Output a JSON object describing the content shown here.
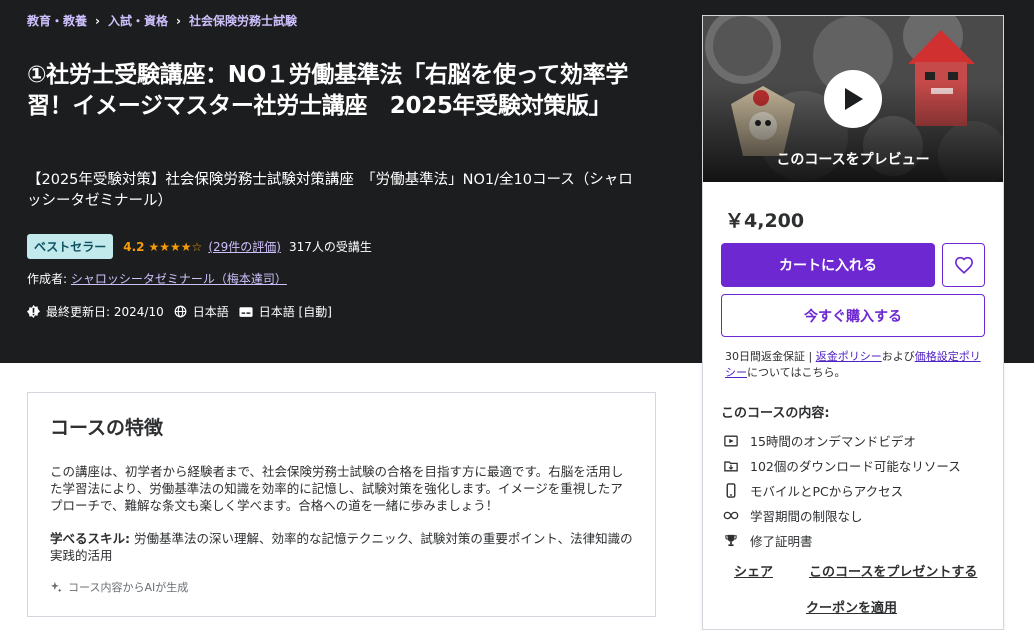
{
  "breadcrumb": [
    "教育・教養",
    "入試・資格",
    "社会保険労務士試験"
  ],
  "course": {
    "title": "①社労士受験講座：NO１労働基準法「右脳を使って効率学習！イメージマスター社労士講座　2025年受験対策版」",
    "subtitle": "【2025年受験対策】社会保険労務士試験対策講座　「労働基準法」NO1/全10コース（シャロッシータゼミナール）",
    "badge": "ベストセラー",
    "rating": "4.2",
    "stars": "★★★★☆",
    "reviews": "(29件の評価)",
    "students": "317人の受講生",
    "author_label": "作成者:",
    "author": "シャロッシータゼミナール（梅本達司）",
    "updated": "最終更新日: 2024/10",
    "language": "日本語",
    "captions": "日本語 [自動]"
  },
  "sidebar": {
    "preview_label": "このコースをプレビュー",
    "price": "￥4,200",
    "cart_label": "カートに入れる",
    "buy_label": "今すぐ購入する",
    "guarantee_prefix": "30日間返金保証 | ",
    "refund_policy": "返金ポリシー",
    "and": "および",
    "pricing_policy": "価格設定ポリシー",
    "guarantee_suffix": "についてはこちら。",
    "includes_title": "このコースの内容:",
    "includes": [
      {
        "icon": "video-icon",
        "text": "15時間のオンデマンドビデオ"
      },
      {
        "icon": "download-icon",
        "text": "102個のダウンロード可能なリソース"
      },
      {
        "icon": "mobile-icon",
        "text": "モバイルとPCからアクセス"
      },
      {
        "icon": "infinity-icon",
        "text": "学習期間の制限なし"
      },
      {
        "icon": "trophy-icon",
        "text": "修了証明書"
      }
    ],
    "share_label": "シェア",
    "gift_label": "このコースをプレゼントする",
    "coupon_label": "クーポンを適用"
  },
  "features": {
    "title": "コースの特徴",
    "description": "この講座は、初学者から経験者まで、社会保険労務士試験の合格を目指す方に最適です。右脳を活用した学習法により、労働基準法の知識を効率的に記憶し、試験対策を強化します。イメージを重視したアプローチで、難解な条文も楽しく学べます。合格への道を一緒に歩みましょう！",
    "skills_label": "学べるスキル:",
    "skills": " 労働基準法の深い理解、効率的な記憶テクニック、試験対策の重要ポイント、法律知識の実践的活用",
    "ai_note": "コース内容からAIが生成"
  },
  "colors": {
    "hero_bg": "#1c1d1f",
    "accent": "#6d28d2",
    "link_light": "#cec0fc",
    "star": "#f69c08",
    "badge_bg": "#c2e9eb"
  }
}
